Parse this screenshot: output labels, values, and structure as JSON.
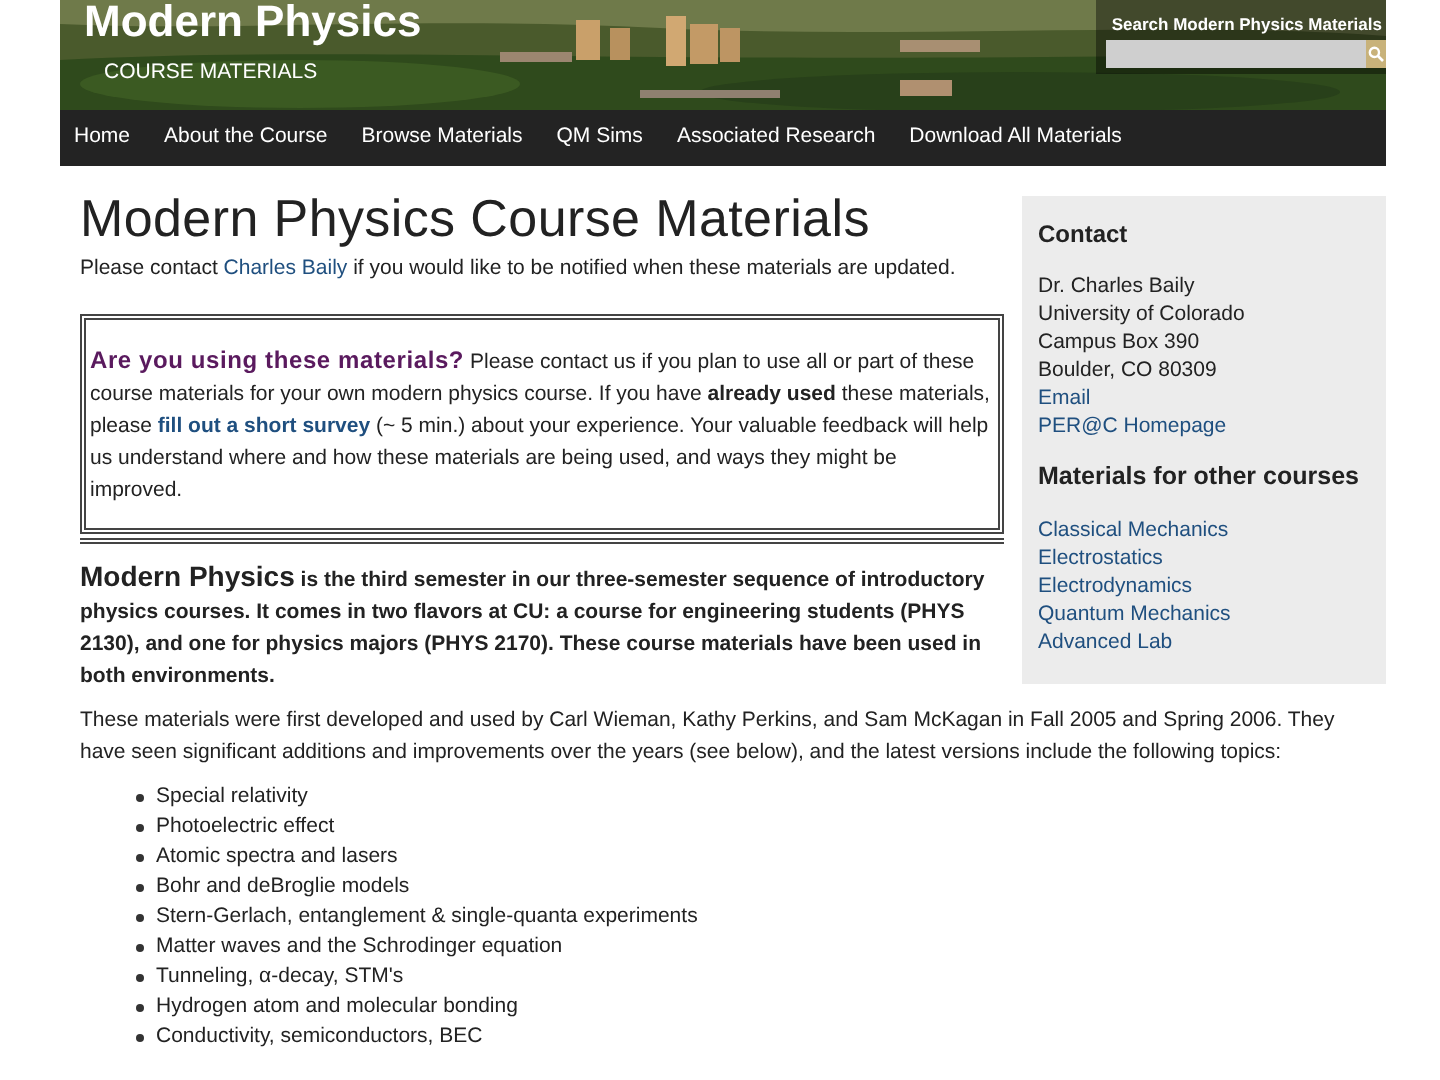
{
  "header": {
    "site_title": "Modern Physics",
    "subtitle": "COURSE MATERIALS",
    "search": {
      "label": "Search Modern Physics Materials"
    }
  },
  "nav": [
    "Home",
    "About the Course",
    "Browse Materials",
    "QM Sims",
    "Associated Research",
    "Download All Materials"
  ],
  "page_title": "Modern Physics Course Materials",
  "intro": [
    {
      "kind": "text",
      "text": "Please contact "
    },
    {
      "kind": "link",
      "text": "Charles Baily"
    },
    {
      "kind": "text",
      "text": " if you would like to be notified when these materials are updated."
    }
  ],
  "notice": [
    {
      "kind": "lead",
      "text": "Are you using these materials?"
    },
    {
      "kind": "text",
      "text": " Please contact us if you plan to use all or part of these course materials for your own modern physics course. If you have "
    },
    {
      "kind": "bold",
      "text": "already used"
    },
    {
      "kind": "text",
      "text": " these materials, please "
    },
    {
      "kind": "link",
      "text": "fill out a short survey"
    },
    {
      "kind": "text",
      "text": " (~ 5 min.) about your experience. Your valuable feedback will help us understand where and how these materials are being used, and ways they might be improved."
    }
  ],
  "summary": [
    {
      "kind": "lead",
      "text": "Modern Physics"
    },
    {
      "kind": "bold",
      "text": " is the third semester in our three-semester sequence of introductory physics courses. It comes in two flavors at CU: a course for engineering students (PHYS 2130), and one for physics majors (PHYS 2170). These course materials have been used in both environments."
    }
  ],
  "history": "These materials were first developed and used by Carl Wieman, Kathy Perkins, and Sam McKagan in Fall 2005 and Spring 2006. They have seen significant additions and improvements over the years (see below), and the latest versions include the following topics:",
  "topics": [
    "Special relativity",
    "Photoelectric effect",
    "Atomic spectra and lasers",
    "Bohr and deBroglie models",
    "Stern-Gerlach, entanglement & single-quanta experiments",
    "Matter waves and the Schrodinger equation",
    "Tunneling, α-decay, STM's",
    "Hydrogen atom and molecular bonding",
    "Conductivity, semiconductors, BEC"
  ],
  "sidebar": {
    "contact_heading": "Contact",
    "contact": [
      {
        "kind": "text",
        "text": "Dr. Charles Baily"
      },
      {
        "kind": "text",
        "text": "University of Colorado"
      },
      {
        "kind": "text",
        "text": "Campus Box 390"
      },
      {
        "kind": "text",
        "text": "Boulder, CO 80309"
      },
      {
        "kind": "link",
        "text": "Email"
      },
      {
        "kind": "link",
        "text": "PER@C Homepage"
      }
    ],
    "courses_heading": "Materials for other courses",
    "courses": [
      "Classical Mechanics",
      "Electrostatics",
      "Electrodynamics",
      "Quantum Mechanics",
      "Advanced Lab"
    ]
  }
}
